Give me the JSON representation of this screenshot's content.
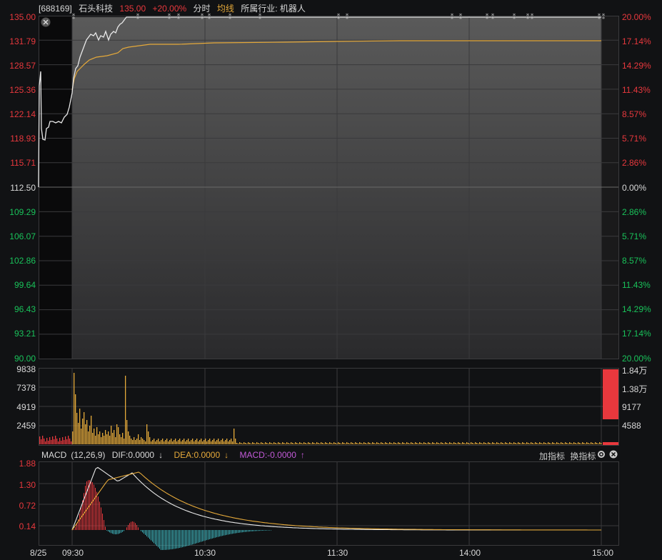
{
  "header": {
    "code": "[688169]",
    "name": "石头科技",
    "price": "135.00",
    "change": "+20.00%",
    "mode": "分时",
    "avg_line": "均线",
    "industry": "所属行业: 机器人"
  },
  "price_axis": {
    "left": [
      "135.00",
      "131.79",
      "128.57",
      "125.36",
      "122.14",
      "118.93",
      "115.71",
      "112.50",
      "109.29",
      "106.07",
      "102.86",
      "99.64",
      "96.43",
      "93.21",
      "90.00"
    ],
    "right": [
      "20.00%",
      "17.14%",
      "14.29%",
      "11.43%",
      "8.57%",
      "5.71%",
      "2.86%",
      "0.00%",
      "2.86%",
      "5.71%",
      "8.57%",
      "11.43%",
      "14.29%",
      "17.14%",
      "20.00%"
    ]
  },
  "volume_axis": {
    "left": [
      "9838",
      "7378",
      "4919",
      "2459"
    ],
    "right": [
      "1.84万",
      "1.38万",
      "9177",
      "4588"
    ]
  },
  "macd": {
    "title": "MACD",
    "params": "(12,26,9)",
    "dif": "DIF:0.0000",
    "dif_arrow": "↓",
    "dea": "DEA:0.0000",
    "dea_arrow": "↓",
    "macd": "MACD:-0.0000",
    "macd_arrow": "↑",
    "add_indicator": "加指标",
    "switch_indicator": "换指标",
    "axis": [
      "1.88",
      "1.30",
      "0.72",
      "0.14"
    ]
  },
  "x_axis": [
    "8/25",
    "09:30",
    "10:30",
    "11:30",
    "14:00",
    "15:00"
  ],
  "colors": {
    "up": "#e8383d",
    "down": "#19c25a",
    "price_line": "#e8e8e8",
    "avg_line": "#e5a93a",
    "macd_pos": "#e8383d",
    "macd_neg": "#3fb8c0"
  }
}
